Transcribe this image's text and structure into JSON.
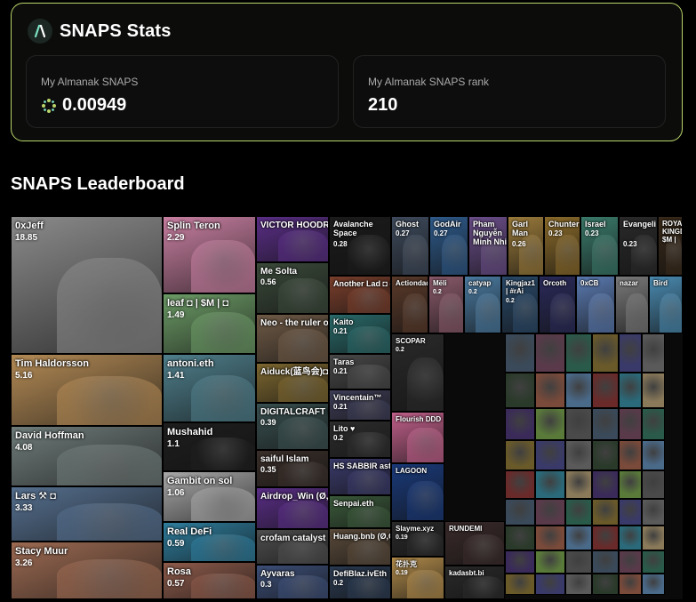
{
  "stats": {
    "title": "SNAPS Stats",
    "my_snaps_label": "My Almanak SNAPS",
    "my_snaps_value": "0.00949",
    "my_rank_label": "My Almanak SNAPS rank",
    "my_rank_value": "210"
  },
  "leaderboard": {
    "title": "SNAPS Leaderboard",
    "entries": [
      {
        "name": "0xJeff",
        "score": "18.85",
        "color": "#8a8a8a"
      },
      {
        "name": "Tim Haldorsson",
        "score": "5.16",
        "color": "#b38a55"
      },
      {
        "name": "David Hoffman",
        "score": "4.08",
        "color": "#6f7c7a"
      },
      {
        "name": "Lars ⚒ ◘",
        "score": "3.33",
        "color": "#556f8e"
      },
      {
        "name": "Stacy Muur",
        "score": "3.26",
        "color": "#9c6a52"
      },
      {
        "name": "Splin Teron",
        "score": "2.29",
        "color": "#c87fa1"
      },
      {
        "name": "leaf ◘ | $M | ◘",
        "score": "1.49",
        "color": "#6c9b66"
      },
      {
        "name": "antoni.eth",
        "score": "1.41",
        "color": "#4f7f8c"
      },
      {
        "name": "Mushahid",
        "score": "1.1",
        "color": "#1e1e1e"
      },
      {
        "name": "Gambit on sol",
        "score": "1.06",
        "color": "#a9a9a9"
      },
      {
        "name": "Real DeFi",
        "score": "0.59",
        "color": "#2f7e9e"
      },
      {
        "name": "Rosa",
        "score": "0.57",
        "color": "#8e5b4b"
      },
      {
        "name": "VICTOR HOODRICH",
        "score": "",
        "color": "#5a2e86"
      },
      {
        "name": "Me Solta",
        "score": "0.56",
        "color": "#3b4a3a"
      },
      {
        "name": "Neo - the ruler of agents that",
        "score": "",
        "color": "#6f5a46"
      },
      {
        "name": "Aiduck(蓝鸟会)◘ 长期互关",
        "score": "",
        "color": "#7d6730"
      },
      {
        "name": "DIGITALCRAFT BAG (ØG)",
        "score": "0.39",
        "color": "#3a5050"
      },
      {
        "name": "saiful Islam",
        "score": "0.35",
        "color": "#3a2f2a"
      },
      {
        "name": "Airdrop_Win (Ø,G)",
        "score": "",
        "color": "#5a2e86"
      },
      {
        "name": "crofam catalyst",
        "score": "",
        "color": "#4e4e4e"
      },
      {
        "name": "Ayvaras",
        "score": "0.3",
        "color": "#3d4f78"
      },
      {
        "name": "Avalanche Space",
        "score": "0.28",
        "color": "#1b1b1b"
      },
      {
        "name": "Another Lad ◘ (Ø,G)",
        "score": "",
        "color": "#7a3f2c"
      },
      {
        "name": "Kaito",
        "score": "0.21",
        "color": "#2a6a6a"
      },
      {
        "name": "Taras",
        "score": "0.21",
        "color": "#4a4a4a"
      },
      {
        "name": "Vincentain™",
        "score": "0.21",
        "color": "#3e3e58"
      },
      {
        "name": "Lito ♥",
        "score": "0.2",
        "color": "#2d2d2d"
      },
      {
        "name": "HS SABBIR asterai.xyz",
        "score": "",
        "color": "#3a3a6a"
      },
      {
        "name": "Senpai.eth",
        "score": "",
        "color": "#3b5a3b"
      },
      {
        "name": "Huang.bnb (Ø,G)",
        "score": "",
        "color": "#5a4a3a"
      },
      {
        "name": "DefiBlaz.ivEth",
        "score": "0.2",
        "color": "#2b3b52"
      },
      {
        "name": "Ghost",
        "score": "0.27",
        "color": "#3e4a5c"
      },
      {
        "name": "GodAir",
        "score": "0.27",
        "color": "#2e5a8a"
      },
      {
        "name": "Pham Nguyễn Minh Nhi",
        "score": "",
        "color": "#6b4e8a"
      },
      {
        "name": "Garl Man",
        "score": "0.26",
        "color": "#9a7a3a"
      },
      {
        "name": "Chunter",
        "score": "0.23",
        "color": "#8a6a2a"
      },
      {
        "name": "Israel",
        "score": "0.23",
        "color": "#3a7a6a"
      },
      {
        "name": "Evangeli",
        "score": "0.23",
        "color": "#2a2a2a"
      },
      {
        "name": "ROYAL KINGDO $M |",
        "score": "",
        "color": "#3a2a1a"
      },
      {
        "name": "Actiondad",
        "score": "",
        "color": "#5a3a2a"
      },
      {
        "name": "Mëli",
        "score": "0.2",
        "color": "#8a5a6a"
      },
      {
        "name": "catyap",
        "score": "0.2",
        "color": "#4a7aa0"
      },
      {
        "name": "Kingjaz1 | #rAi",
        "score": "0.2",
        "color": "#2a4a6a"
      },
      {
        "name": "Orcoth",
        "score": "",
        "color": "#2a2a5a"
      },
      {
        "name": "0xCB",
        "score": "",
        "color": "#5a7ab0"
      },
      {
        "name": "nazar",
        "score": "",
        "color": "#7a7a7a"
      },
      {
        "name": "Bird",
        "score": "",
        "color": "#4a8ab0"
      },
      {
        "name": "SCOPAR",
        "score": "0.2",
        "color": "#2a2a2a"
      },
      {
        "name": "Flourish DDD",
        "score": "",
        "color": "#c0608a"
      },
      {
        "name": "LAGOON",
        "score": "",
        "color": "#1a3a7a"
      },
      {
        "name": "Slayme.xyz",
        "score": "0.19",
        "color": "#2a2a2a"
      },
      {
        "name": "花扑克",
        "score": "0.19",
        "color": "#b08a4a"
      },
      {
        "name": "RUNDEMI",
        "score": "",
        "color": "#3a2a2a"
      },
      {
        "name": "kadasbt.bi",
        "score": "",
        "color": "#2a2a2a"
      }
    ]
  }
}
